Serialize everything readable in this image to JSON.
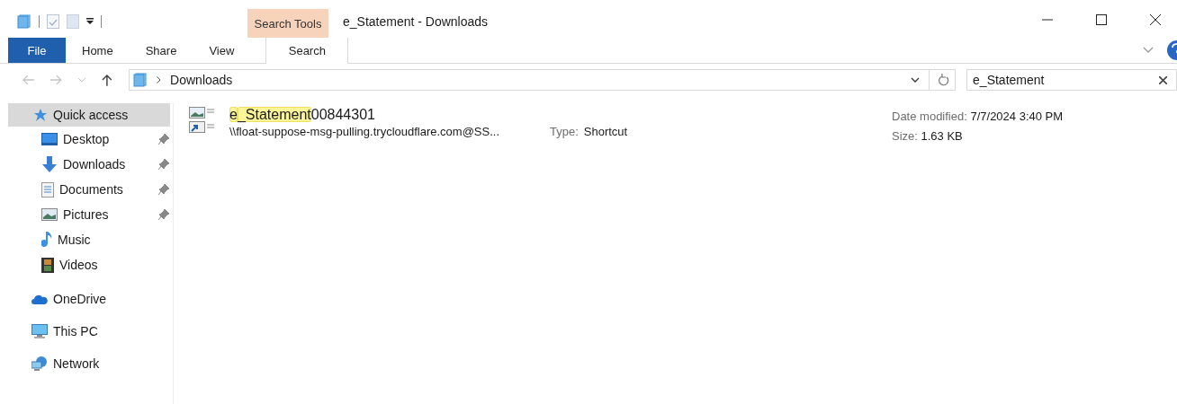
{
  "window": {
    "title": "e_Statement - Downloads"
  },
  "context_tab": {
    "label": "Search Tools"
  },
  "ribbon_tabs": [
    {
      "label": "File",
      "selected": false,
      "kind": "file"
    },
    {
      "label": "Home",
      "selected": false,
      "kind": "tab"
    },
    {
      "label": "Share",
      "selected": false,
      "kind": "tab"
    },
    {
      "label": "View",
      "selected": false,
      "kind": "tab"
    },
    {
      "label": "Search",
      "selected": true,
      "kind": "tab"
    }
  ],
  "address_bar": {
    "path": "Downloads"
  },
  "search": {
    "value": "e_Statement"
  },
  "sidebar": {
    "items": [
      {
        "label": "Quick access",
        "selected": true,
        "children": [
          {
            "label": "Desktop",
            "pinned": true
          },
          {
            "label": "Downloads",
            "pinned": true
          },
          {
            "label": "Documents",
            "pinned": true
          },
          {
            "label": "Pictures",
            "pinned": true
          },
          {
            "label": "Music",
            "pinned": false
          },
          {
            "label": "Videos",
            "pinned": false
          }
        ]
      },
      {
        "label": "OneDrive",
        "selected": false
      },
      {
        "label": "This PC",
        "selected": false
      },
      {
        "label": "Network",
        "selected": false
      }
    ]
  },
  "results": [
    {
      "name": [
        {
          "text": "e",
          "highlighted": true
        },
        {
          "text": "_Statement",
          "highlighted": true
        },
        {
          "text": "00844301",
          "highlighted": false
        }
      ],
      "target": "\\\\float-suppose-msg-pulling.trycloudflare.com@SS...",
      "type_label": "Type:",
      "type_value": "Shortcut",
      "date_label": "Date modified:",
      "date_value": "7/7/2024 3:40 PM",
      "size_label": "Size:",
      "size_value": "1.63 KB"
    }
  ]
}
